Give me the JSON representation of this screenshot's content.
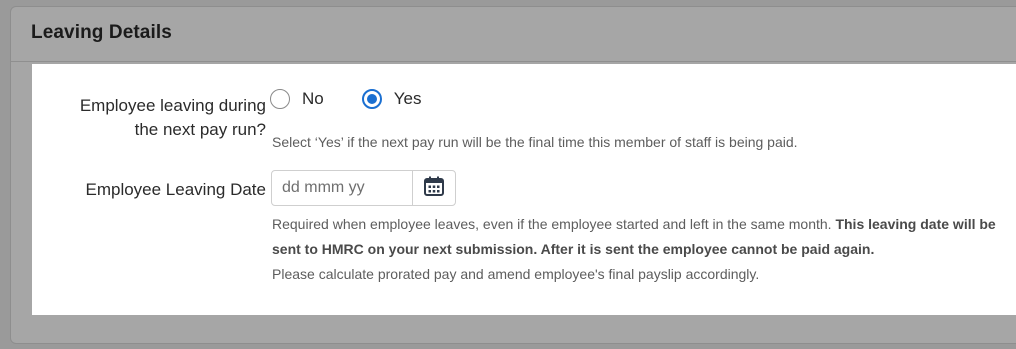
{
  "section": {
    "title": "Leaving Details"
  },
  "leaving_next_run": {
    "label_line1": "Employee leaving during",
    "label_line2": "the next pay run?",
    "options": [
      {
        "label": "No",
        "selected": false
      },
      {
        "label": "Yes",
        "selected": true
      }
    ],
    "hint": "Select ‘Yes’ if the next pay run will be the final time this member of staff is being paid."
  },
  "leaving_date": {
    "label": "Employee Leaving Date",
    "value": "",
    "placeholder": "dd mmm yy",
    "calendar_icon": "calendar-icon",
    "hint_plain": "Required when employee leaves, even if the employee started and left in the same month. ",
    "hint_bold": "This leaving date will be sent to HMRC on your next submission. After it is sent the employee cannot be paid again.",
    "hint_note": "Please calculate prorated pay and amend employee's final payslip accordingly."
  },
  "colors": {
    "accent": "#1a6fd1",
    "overlay": "#a6a6a6",
    "text": "#2b2b2b",
    "hint": "#5d5d5d"
  }
}
